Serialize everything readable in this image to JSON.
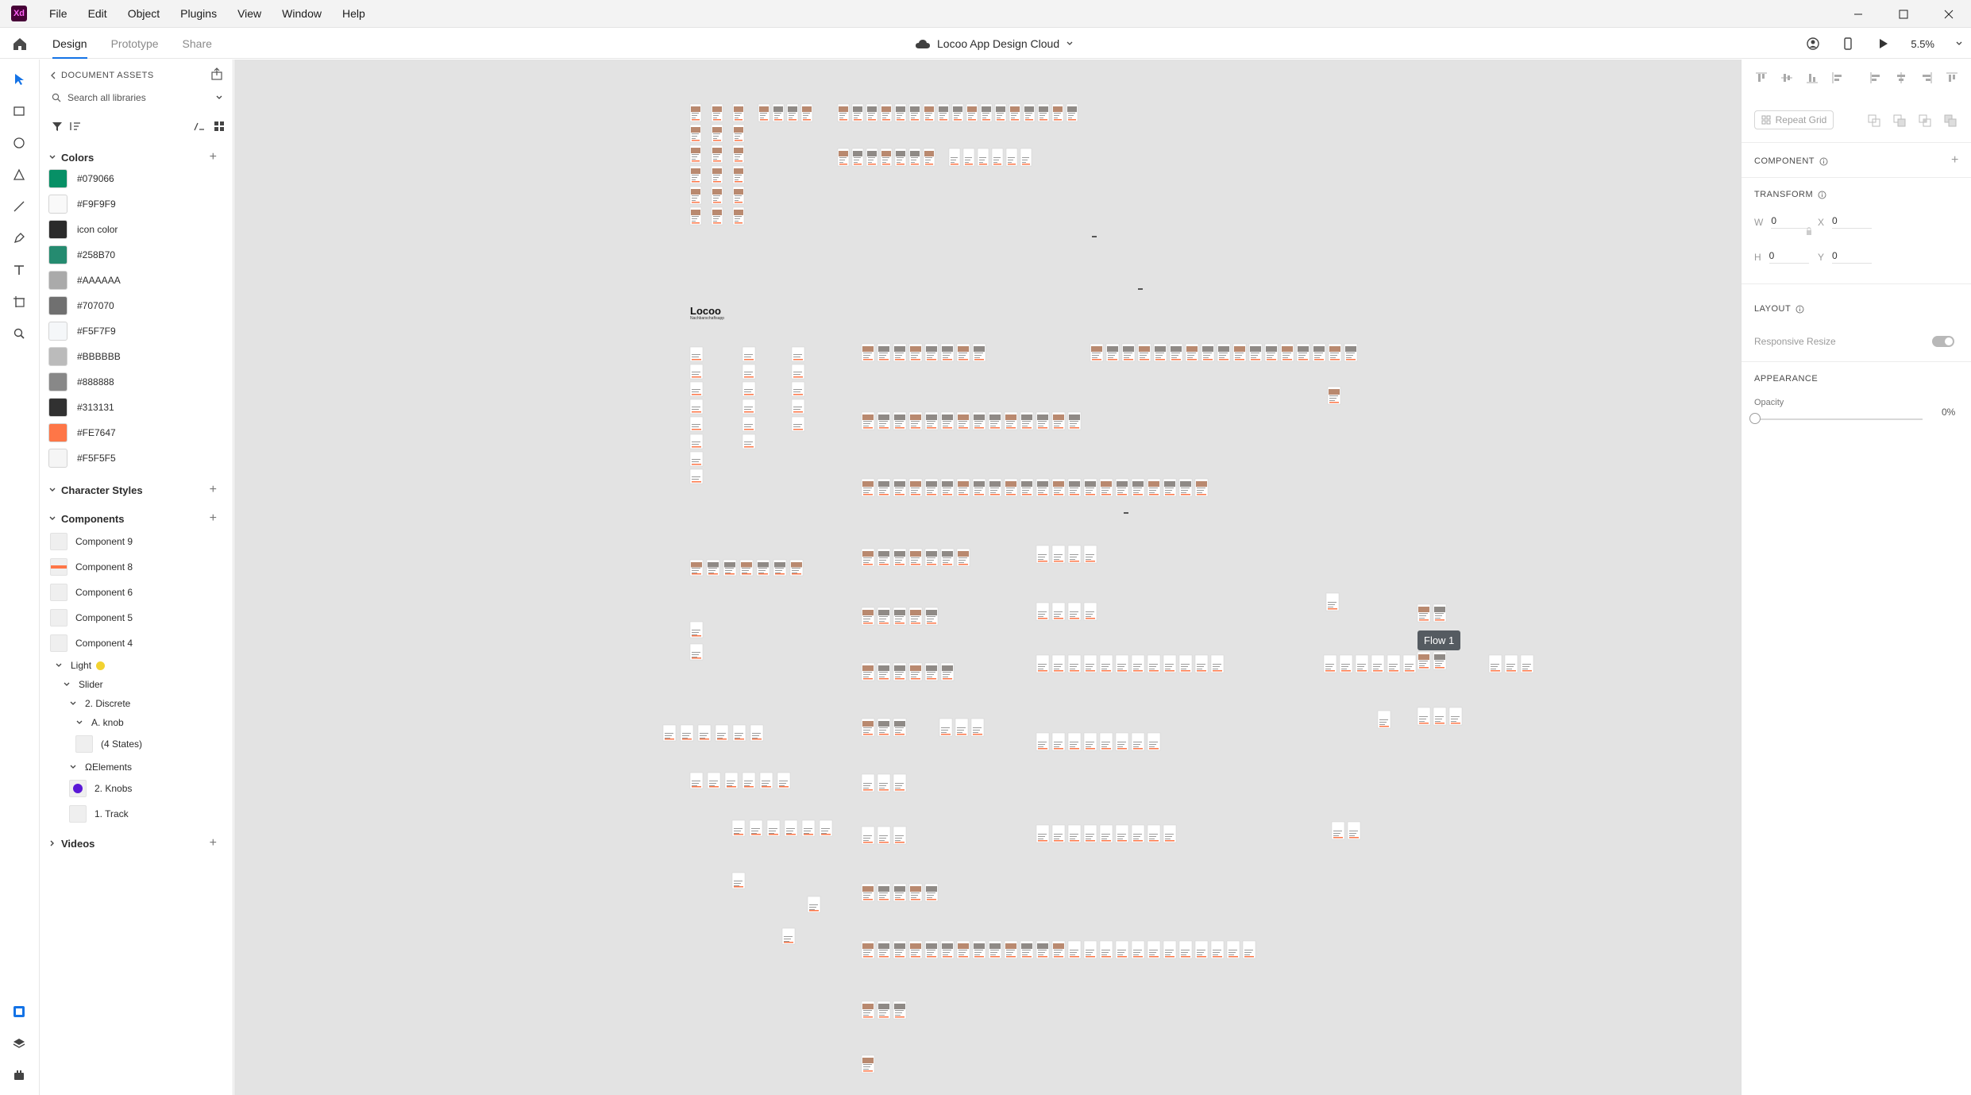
{
  "menubar": {
    "logo": "Xd",
    "items": [
      "File",
      "Edit",
      "Object",
      "Plugins",
      "View",
      "Window",
      "Help"
    ]
  },
  "tabs": [
    {
      "label": "Design",
      "active": true
    },
    {
      "label": "Prototype",
      "active": false
    },
    {
      "label": "Share",
      "active": false
    }
  ],
  "document": {
    "title": "Locoo App Design Cloud"
  },
  "zoom": "5.5%",
  "assets": {
    "heading": "DOCUMENT ASSETS",
    "search_placeholder": "Search all libraries",
    "colors_heading": "Colors",
    "colors": [
      {
        "name": "#079066",
        "hex": "#079066"
      },
      {
        "name": "#F9F9F9",
        "hex": "#F9F9F9"
      },
      {
        "name": "icon color",
        "hex": "#2a2a2a"
      },
      {
        "name": "#258B70",
        "hex": "#258B70"
      },
      {
        "name": "#AAAAAA",
        "hex": "#AAAAAA"
      },
      {
        "name": "#707070",
        "hex": "#707070"
      },
      {
        "name": "#F5F7F9",
        "hex": "#F5F7F9"
      },
      {
        "name": "#BBBBBB",
        "hex": "#BBBBBB"
      },
      {
        "name": "#888888",
        "hex": "#888888"
      },
      {
        "name": "#313131",
        "hex": "#313131"
      },
      {
        "name": "#FE7647",
        "hex": "#FE7647"
      },
      {
        "name": "#F5F5F5",
        "hex": "#F5F5F5"
      }
    ],
    "character_styles_heading": "Character Styles",
    "components_heading": "Components",
    "components": [
      "Component 9",
      "Component 8",
      "Component 6",
      "Component 5",
      "Component 4"
    ],
    "tree": {
      "light": "Light",
      "slider": "Slider",
      "discrete": "2. Discrete",
      "knob": "A. knob",
      "states": "(4 States)",
      "elements": "ΩElements",
      "knobs": "2. Knobs",
      "track": "1. Track"
    },
    "videos_heading": "Videos"
  },
  "canvas": {
    "flow_label": "Flow 1",
    "logo": "Locoo",
    "logo_sub": "Nachbarschaftsapp"
  },
  "inspector": {
    "repeat_grid": "Repeat Grid",
    "component_heading": "COMPONENT",
    "transform_heading": "TRANSFORM",
    "w_label": "W",
    "w_value": "0",
    "x_label": "X",
    "x_value": "0",
    "h_label": "H",
    "h_value": "0",
    "y_label": "Y",
    "y_value": "0",
    "layout_heading": "LAYOUT",
    "responsive_resize": "Responsive Resize",
    "appearance_heading": "APPEARANCE",
    "opacity_label": "Opacity",
    "opacity_value": "0%"
  },
  "accent": {
    "orange": "#FE7647",
    "selection_blue": "#1473e6",
    "knob_purple": "#5a18d6",
    "light_yellow": "#f2d230"
  }
}
